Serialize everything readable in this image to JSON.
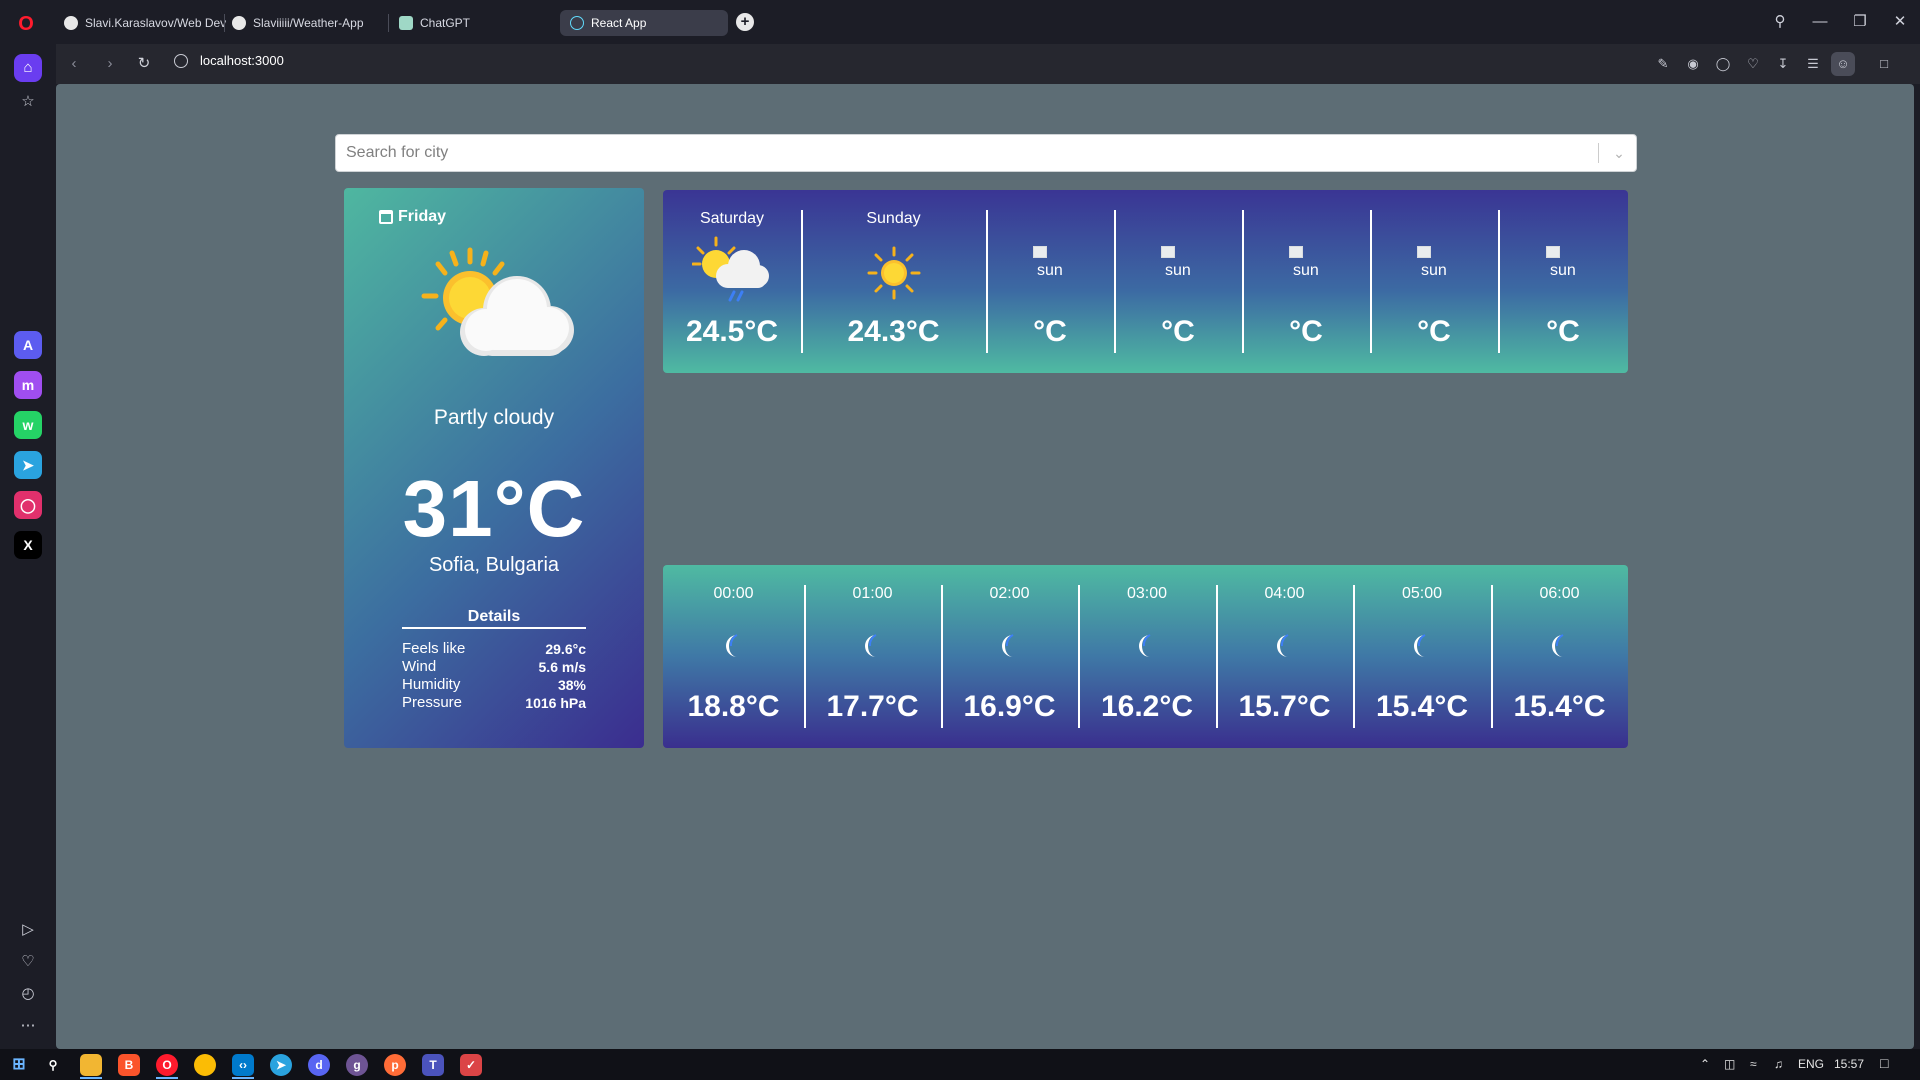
{
  "browser": {
    "tabs": [
      {
        "label": "Slavi.Karaslavov/Web Dev",
        "icon": "github-icon",
        "active": false
      },
      {
        "label": "Slaviiiii/Weather-App",
        "icon": "github-icon",
        "active": false
      },
      {
        "label": "ChatGPT",
        "icon": "chatgpt-icon",
        "active": false
      },
      {
        "label": "React App",
        "icon": "react-icon",
        "active": true
      }
    ],
    "url": "localhost:3000"
  },
  "search": {
    "placeholder": "Search for city"
  },
  "current": {
    "day": "Friday",
    "condition": "Partly cloudy",
    "temperature": "31°C",
    "location": "Sofia, Bulgaria",
    "details_title": "Details",
    "details": [
      {
        "label": "Feels like",
        "value": "29.6°c"
      },
      {
        "label": "Wind",
        "value": "5.6 m/s"
      },
      {
        "label": "Humidity",
        "value": "38%"
      },
      {
        "label": "Pressure",
        "value": "1016 hPa"
      }
    ]
  },
  "daily_forecast": [
    {
      "day": "Saturday",
      "temp": "24.5°C",
      "icon": "partly-cloudy-rain-icon",
      "broken": false
    },
    {
      "day": "Sunday",
      "temp": "24.3°C",
      "icon": "sun-icon",
      "broken": false
    },
    {
      "day": "",
      "temp": "°C",
      "alt": "sun",
      "broken": true
    },
    {
      "day": "",
      "temp": "°C",
      "alt": "sun",
      "broken": true
    },
    {
      "day": "",
      "temp": "°C",
      "alt": "sun",
      "broken": true
    },
    {
      "day": "",
      "temp": "°C",
      "alt": "sun",
      "broken": true
    },
    {
      "day": "",
      "temp": "°C",
      "alt": "sun",
      "broken": true
    }
  ],
  "hourly_forecast": [
    {
      "time": "00:00",
      "temp": "18.8°C",
      "icon": "moon-icon"
    },
    {
      "time": "01:00",
      "temp": "17.7°C",
      "icon": "moon-icon"
    },
    {
      "time": "02:00",
      "temp": "16.9°C",
      "icon": "moon-icon"
    },
    {
      "time": "03:00",
      "temp": "16.2°C",
      "icon": "moon-icon"
    },
    {
      "time": "04:00",
      "temp": "15.7°C",
      "icon": "moon-icon"
    },
    {
      "time": "05:00",
      "temp": "15.4°C",
      "icon": "moon-icon"
    },
    {
      "time": "06:00",
      "temp": "15.4°C",
      "icon": "moon-icon"
    }
  ],
  "taskbar": {
    "language": "ENG",
    "time": "15:57"
  },
  "colors": {
    "page_background": "#5d6d75",
    "card_teal": "#4fb7a0",
    "card_indigo": "#3b2d8f",
    "opera_red": "#ff1b2d",
    "sidebar_home_accent": "#6a3df0"
  }
}
